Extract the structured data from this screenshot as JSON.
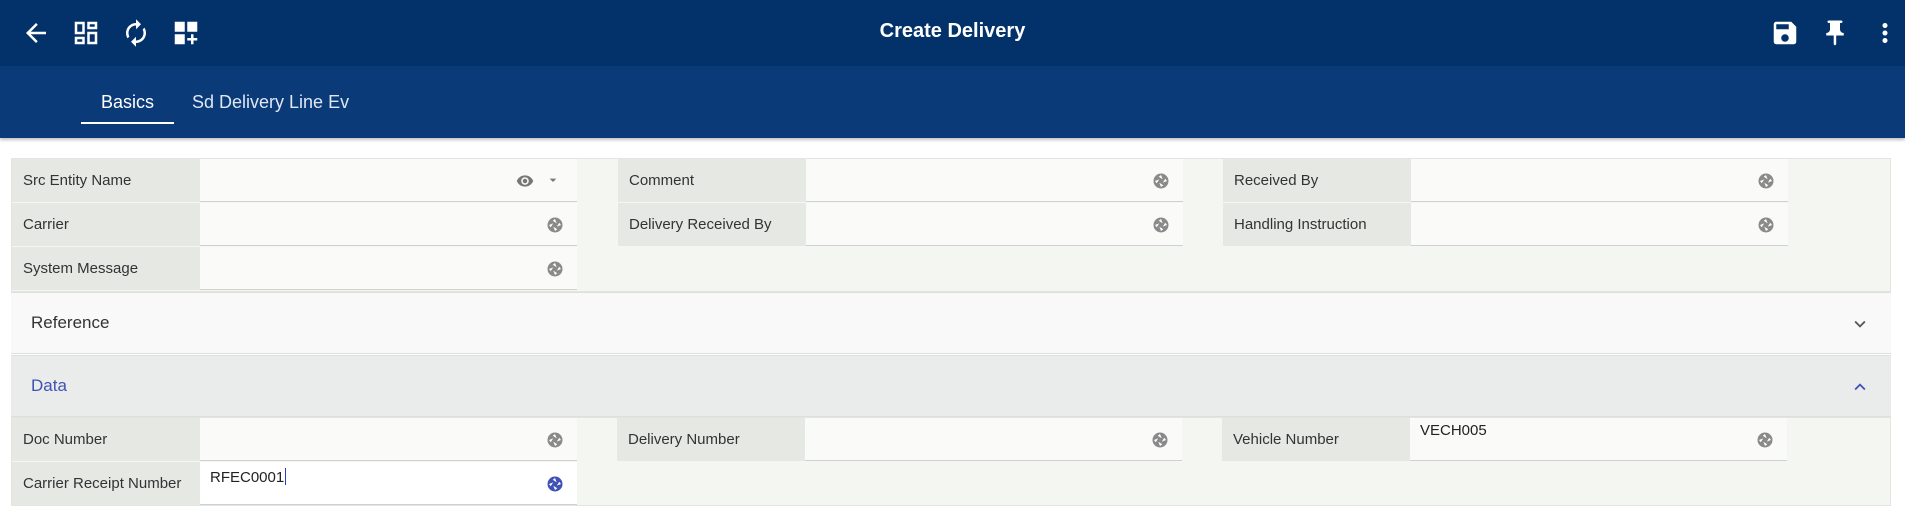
{
  "appbar": {
    "title": "Create Delivery",
    "icons": [
      "arrow-back-icon",
      "dashboard-icon",
      "refresh-icon",
      "add-widget-icon",
      "save-icon",
      "pin-icon",
      "more-vert-icon"
    ]
  },
  "tabs": [
    {
      "label": "Basics",
      "active": true
    },
    {
      "label": "Sd Delivery Line Ev",
      "active": false
    }
  ],
  "basics": {
    "src_entity_name": {
      "label": "Src Entity Name",
      "value": ""
    },
    "comment": {
      "label": "Comment",
      "value": ""
    },
    "received_by": {
      "label": "Received By",
      "value": ""
    },
    "carrier": {
      "label": "Carrier",
      "value": ""
    },
    "delivery_received_by": {
      "label": "Delivery Received By",
      "value": ""
    },
    "handling_instruction": {
      "label": "Handling Instruction",
      "value": ""
    },
    "system_message": {
      "label": "System Message",
      "value": ""
    }
  },
  "reference_section": {
    "title": "Reference",
    "expanded": false
  },
  "data_section": {
    "title": "Data",
    "expanded": true,
    "doc_number": {
      "label": "Doc Number",
      "value": ""
    },
    "delivery_number": {
      "label": "Delivery Number",
      "value": ""
    },
    "vehicle_number": {
      "label": "Vehicle Number",
      "value": "VECH005"
    },
    "carrier_receipt_number": {
      "label": "Carrier Receipt Number",
      "value": "RFEC0001"
    }
  },
  "colors": {
    "appbar": "#03326b",
    "tabbar": "#0a3a78",
    "accent": "#3f51b5"
  }
}
